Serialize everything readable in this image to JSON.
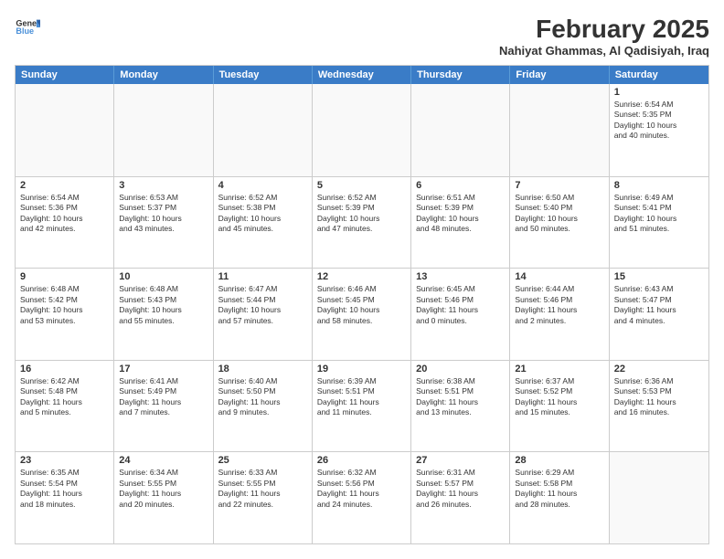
{
  "logo": {
    "line1": "General",
    "line2": "Blue"
  },
  "title": "February 2025",
  "location": "Nahiyat Ghammas, Al Qadisiyah, Iraq",
  "headers": [
    "Sunday",
    "Monday",
    "Tuesday",
    "Wednesday",
    "Thursday",
    "Friday",
    "Saturday"
  ],
  "weeks": [
    [
      {
        "day": "",
        "text": ""
      },
      {
        "day": "",
        "text": ""
      },
      {
        "day": "",
        "text": ""
      },
      {
        "day": "",
        "text": ""
      },
      {
        "day": "",
        "text": ""
      },
      {
        "day": "",
        "text": ""
      },
      {
        "day": "1",
        "text": "Sunrise: 6:54 AM\nSunset: 5:35 PM\nDaylight: 10 hours\nand 40 minutes."
      }
    ],
    [
      {
        "day": "2",
        "text": "Sunrise: 6:54 AM\nSunset: 5:36 PM\nDaylight: 10 hours\nand 42 minutes."
      },
      {
        "day": "3",
        "text": "Sunrise: 6:53 AM\nSunset: 5:37 PM\nDaylight: 10 hours\nand 43 minutes."
      },
      {
        "day": "4",
        "text": "Sunrise: 6:52 AM\nSunset: 5:38 PM\nDaylight: 10 hours\nand 45 minutes."
      },
      {
        "day": "5",
        "text": "Sunrise: 6:52 AM\nSunset: 5:39 PM\nDaylight: 10 hours\nand 47 minutes."
      },
      {
        "day": "6",
        "text": "Sunrise: 6:51 AM\nSunset: 5:39 PM\nDaylight: 10 hours\nand 48 minutes."
      },
      {
        "day": "7",
        "text": "Sunrise: 6:50 AM\nSunset: 5:40 PM\nDaylight: 10 hours\nand 50 minutes."
      },
      {
        "day": "8",
        "text": "Sunrise: 6:49 AM\nSunset: 5:41 PM\nDaylight: 10 hours\nand 51 minutes."
      }
    ],
    [
      {
        "day": "9",
        "text": "Sunrise: 6:48 AM\nSunset: 5:42 PM\nDaylight: 10 hours\nand 53 minutes."
      },
      {
        "day": "10",
        "text": "Sunrise: 6:48 AM\nSunset: 5:43 PM\nDaylight: 10 hours\nand 55 minutes."
      },
      {
        "day": "11",
        "text": "Sunrise: 6:47 AM\nSunset: 5:44 PM\nDaylight: 10 hours\nand 57 minutes."
      },
      {
        "day": "12",
        "text": "Sunrise: 6:46 AM\nSunset: 5:45 PM\nDaylight: 10 hours\nand 58 minutes."
      },
      {
        "day": "13",
        "text": "Sunrise: 6:45 AM\nSunset: 5:46 PM\nDaylight: 11 hours\nand 0 minutes."
      },
      {
        "day": "14",
        "text": "Sunrise: 6:44 AM\nSunset: 5:46 PM\nDaylight: 11 hours\nand 2 minutes."
      },
      {
        "day": "15",
        "text": "Sunrise: 6:43 AM\nSunset: 5:47 PM\nDaylight: 11 hours\nand 4 minutes."
      }
    ],
    [
      {
        "day": "16",
        "text": "Sunrise: 6:42 AM\nSunset: 5:48 PM\nDaylight: 11 hours\nand 5 minutes."
      },
      {
        "day": "17",
        "text": "Sunrise: 6:41 AM\nSunset: 5:49 PM\nDaylight: 11 hours\nand 7 minutes."
      },
      {
        "day": "18",
        "text": "Sunrise: 6:40 AM\nSunset: 5:50 PM\nDaylight: 11 hours\nand 9 minutes."
      },
      {
        "day": "19",
        "text": "Sunrise: 6:39 AM\nSunset: 5:51 PM\nDaylight: 11 hours\nand 11 minutes."
      },
      {
        "day": "20",
        "text": "Sunrise: 6:38 AM\nSunset: 5:51 PM\nDaylight: 11 hours\nand 13 minutes."
      },
      {
        "day": "21",
        "text": "Sunrise: 6:37 AM\nSunset: 5:52 PM\nDaylight: 11 hours\nand 15 minutes."
      },
      {
        "day": "22",
        "text": "Sunrise: 6:36 AM\nSunset: 5:53 PM\nDaylight: 11 hours\nand 16 minutes."
      }
    ],
    [
      {
        "day": "23",
        "text": "Sunrise: 6:35 AM\nSunset: 5:54 PM\nDaylight: 11 hours\nand 18 minutes."
      },
      {
        "day": "24",
        "text": "Sunrise: 6:34 AM\nSunset: 5:55 PM\nDaylight: 11 hours\nand 20 minutes."
      },
      {
        "day": "25",
        "text": "Sunrise: 6:33 AM\nSunset: 5:55 PM\nDaylight: 11 hours\nand 22 minutes."
      },
      {
        "day": "26",
        "text": "Sunrise: 6:32 AM\nSunset: 5:56 PM\nDaylight: 11 hours\nand 24 minutes."
      },
      {
        "day": "27",
        "text": "Sunrise: 6:31 AM\nSunset: 5:57 PM\nDaylight: 11 hours\nand 26 minutes."
      },
      {
        "day": "28",
        "text": "Sunrise: 6:29 AM\nSunset: 5:58 PM\nDaylight: 11 hours\nand 28 minutes."
      },
      {
        "day": "",
        "text": ""
      }
    ]
  ]
}
